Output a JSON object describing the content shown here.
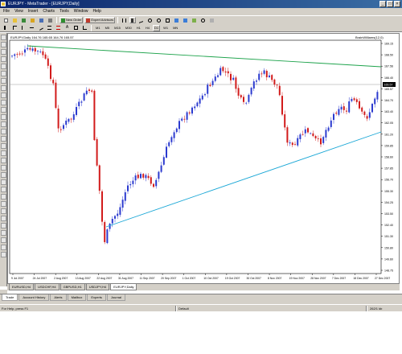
{
  "window": {
    "title": "EURJPY - MetaTrader - [EURJPY,Daily]",
    "minimize": "_",
    "maximize": "□",
    "close": "×"
  },
  "menu": [
    "File",
    "View",
    "Insert",
    "Charts",
    "Tools",
    "Window",
    "Help"
  ],
  "toolbar": {
    "new_order": "New Order",
    "expert_advisors": "Expert Advisors",
    "timeframes": [
      "M1",
      "M5",
      "M15",
      "M30",
      "H1",
      "H4",
      "D1",
      "W1",
      "MN"
    ]
  },
  "chart": {
    "header": "EURJPY,Daily  164.76 165.65 164.76 165.57",
    "indicator_label": "BrainWilliams(12,0)",
    "current_price": "165.57",
    "price_ticks": [
      "169.15",
      "168.50",
      "167.56",
      "166.40",
      "165.57",
      "164.70",
      "163.40",
      "162.05",
      "161.20",
      "159.85",
      "158.60",
      "157.85",
      "156.70",
      "155.30",
      "154.25",
      "153.50",
      "152.40",
      "151.30",
      "150.80",
      "149.60",
      "148.75"
    ],
    "date_ticks": [
      "9 Jul 2007",
      "24 Jul 2007",
      "2 Aug 2007",
      "13 Aug 2007",
      "22 Aug 2007",
      "31 Aug 2007",
      "11 Sep 2007",
      "20 Sep 2007",
      "1 Oct 2007",
      "10 Oct 2007",
      "19 Oct 2007",
      "30 Oct 2007",
      "8 Nov 2007",
      "19 Nov 2007",
      "28 Nov 2007",
      "7 Dec 2007",
      "18 Dec 2007",
      "27 Dec 2007"
    ],
    "colors": {
      "bull": "#2b3acf",
      "bear": "#d21b1b",
      "upper_line": "#1ea34c",
      "lower_line": "#1aa7d6"
    }
  },
  "chart_tabs": [
    "EURUSD,H4",
    "USDCHF,H4",
    "GBPUSD,H1",
    "USDJPY,H4",
    "EURJPY,Daily"
  ],
  "terminal_tabs": [
    "Trade",
    "Account History",
    "Alerts",
    "Mailbox",
    "Experts",
    "Journal"
  ],
  "status": {
    "help": "For Help, press F1",
    "profile": "Default",
    "connection": "262/1 kb"
  }
}
